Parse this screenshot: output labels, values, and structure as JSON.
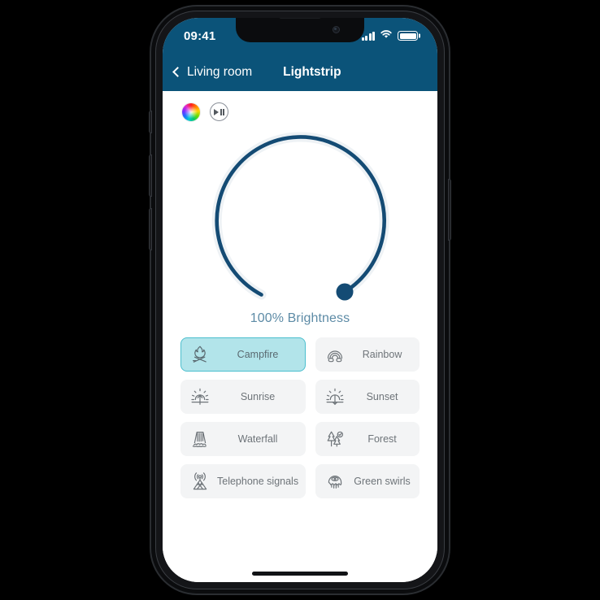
{
  "device": {
    "name": "smartphone-mockup",
    "home_indicator": "home-indicator"
  },
  "status_bar": {
    "time": "09:41",
    "icons": [
      "cellular-signal-icon",
      "wifi-icon",
      "battery-icon"
    ],
    "background_color": "#0b5379"
  },
  "nav_bar": {
    "back_icon": "chevron-left-icon",
    "back_label": "Living room",
    "title": "Lightstrip",
    "background_color": "#0b5379",
    "text_color": "#ffffff"
  },
  "top_actions": [
    {
      "name": "color-wheel-button",
      "icon": "color-wheel-icon",
      "label": ""
    },
    {
      "name": "play-pause-button",
      "icon": "play-pause-icon",
      "label": ""
    }
  ],
  "brightness": {
    "value": 100,
    "label": "100% Brightness",
    "track_color": "#e9eef2",
    "arc_color": "#144b74",
    "knob_color": "#144b74",
    "label_color": "#5d8ba6"
  },
  "scenes": {
    "selected": "Campfire",
    "selected_background": "#b2e4ea",
    "selected_border": "#4cbfce",
    "tile_background": "#f3f4f5",
    "items": [
      {
        "label": "Campfire",
        "icon": "campfire-icon",
        "selected": true
      },
      {
        "label": "Rainbow",
        "icon": "rainbow-icon",
        "selected": false
      },
      {
        "label": "Sunrise",
        "icon": "sunrise-icon",
        "selected": false
      },
      {
        "label": "Sunset",
        "icon": "sunset-icon",
        "selected": false
      },
      {
        "label": "Waterfall",
        "icon": "waterfall-icon",
        "selected": false
      },
      {
        "label": "Forest",
        "icon": "forest-icon",
        "selected": false
      },
      {
        "label": "Telephone signals",
        "icon": "radio-tower-icon",
        "selected": false
      },
      {
        "label": "Green swirls",
        "icon": "jellyfish-icon",
        "selected": false
      }
    ]
  }
}
